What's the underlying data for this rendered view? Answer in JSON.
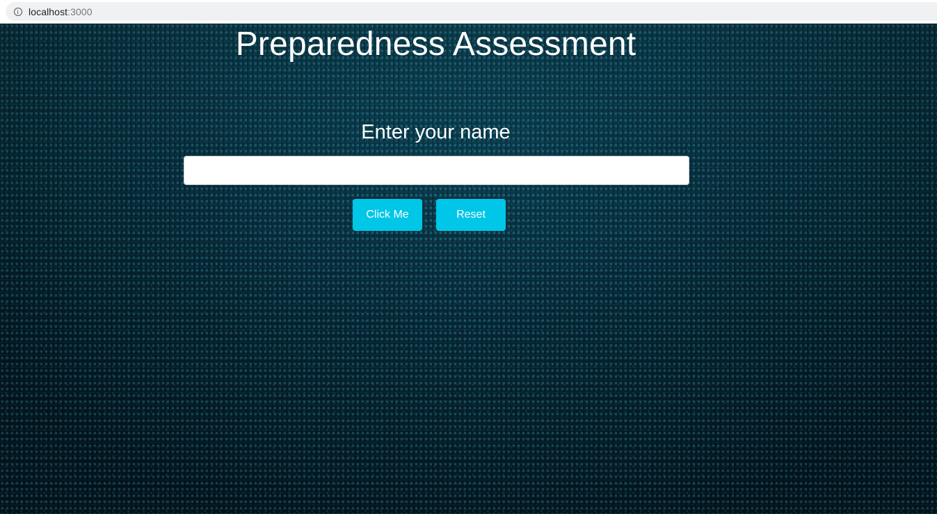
{
  "browser": {
    "url_host": "localhost",
    "url_port": ":3000"
  },
  "main": {
    "title": "Preparedness Assessment",
    "name_label": "Enter your name",
    "name_input_value": "",
    "click_button_label": "Click Me",
    "reset_button_label": "Reset"
  },
  "colors": {
    "button_accent": "#00c6e7",
    "background": "#07212e"
  }
}
